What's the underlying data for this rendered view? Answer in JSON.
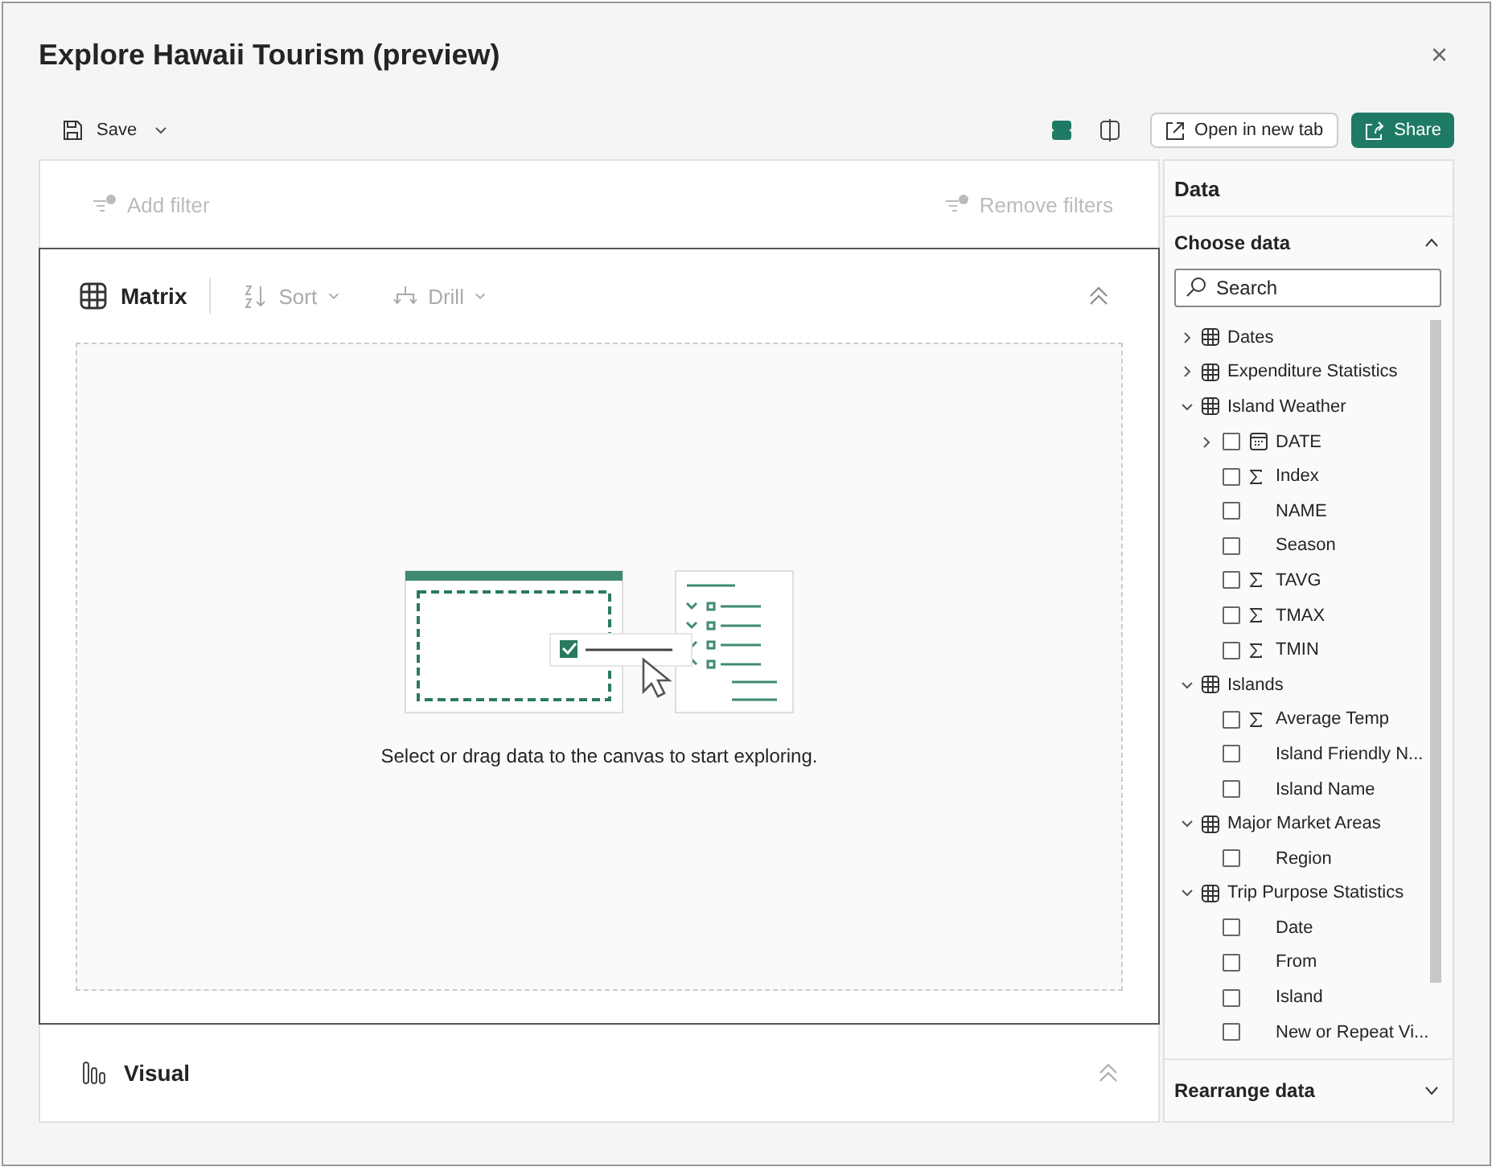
{
  "window": {
    "title": "Explore Hawaii Tourism (preview)",
    "close": "×"
  },
  "toolbar": {
    "save": "Save",
    "layout_options": [
      {
        "kind": "stacked",
        "selected": true
      },
      {
        "kind": "split",
        "selected": false
      }
    ],
    "open_new_tab": "Open in new tab",
    "share": "Share"
  },
  "filters": {
    "add": {
      "label": "Add filter",
      "disabled": true
    },
    "remove": {
      "label": "Remove filters",
      "disabled": true
    }
  },
  "matrix": {
    "title": "Matrix",
    "sort": {
      "label": "Sort",
      "disabled": true
    },
    "drill": {
      "label": "Drill",
      "disabled": true
    },
    "empty_message": "Select or drag data to the canvas to start exploring."
  },
  "visual": {
    "title": "Visual"
  },
  "data_pane": {
    "title": "Data",
    "choose_data": "Choose data",
    "search": {
      "placeholder": "Search"
    },
    "tables": [
      {
        "name": "Dates",
        "expanded": false
      },
      {
        "name": "Expenditure Statistics",
        "expanded": false
      },
      {
        "name": "Island Weather",
        "expanded": true,
        "children": [
          {
            "name": "DATE",
            "kind": "hierarchy",
            "checked": false
          },
          {
            "name": "Index",
            "kind": "sum",
            "checked": false
          },
          {
            "name": "NAME",
            "kind": "text",
            "checked": false
          },
          {
            "name": "Season",
            "kind": "text",
            "checked": false
          },
          {
            "name": "TAVG",
            "kind": "sum",
            "checked": false
          },
          {
            "name": "TMAX",
            "kind": "sum",
            "checked": false
          },
          {
            "name": "TMIN",
            "kind": "sum",
            "checked": false
          }
        ]
      },
      {
        "name": "Islands",
        "expanded": true,
        "children": [
          {
            "name": "Average Temp",
            "kind": "sum",
            "checked": false
          },
          {
            "name": "Island Friendly N...",
            "kind": "text",
            "checked": false
          },
          {
            "name": "Island Name",
            "kind": "text",
            "checked": false
          }
        ]
      },
      {
        "name": "Major Market Areas",
        "expanded": true,
        "children": [
          {
            "name": "Region",
            "kind": "text",
            "checked": false
          }
        ]
      },
      {
        "name": "Trip Purpose Statistics",
        "expanded": true,
        "children": [
          {
            "name": "Date",
            "kind": "text",
            "checked": false
          },
          {
            "name": "From",
            "kind": "text",
            "checked": false
          },
          {
            "name": "Island",
            "kind": "text",
            "checked": false
          },
          {
            "name": "New or Repeat Vi...",
            "kind": "text",
            "checked": false
          }
        ]
      }
    ],
    "rearrange": "Rearrange data"
  }
}
